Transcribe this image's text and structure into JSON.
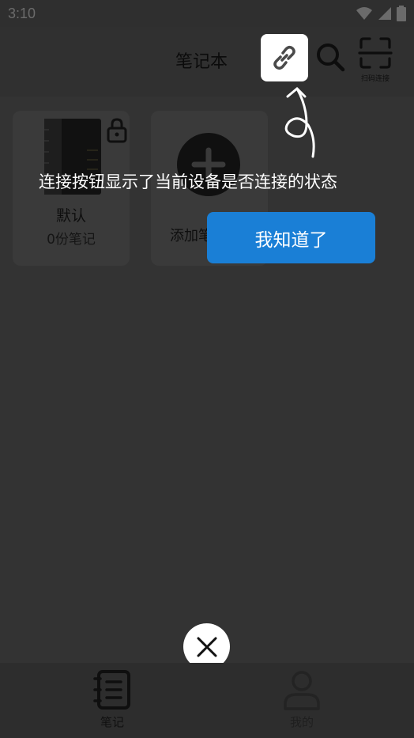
{
  "status": {
    "time": "3:10"
  },
  "header": {
    "title": "笔记本",
    "scan_label": "扫码连接"
  },
  "notebooks": [
    {
      "name": "默认",
      "count": "0份笔记"
    }
  ],
  "add_notebook": {
    "label": "添加笔"
  },
  "coach": {
    "tip": "连接按钮显示了当前设备是否连接的状态",
    "ok_label": "我知道了"
  },
  "tabs": [
    {
      "label": "笔记"
    },
    {
      "label": "我的"
    }
  ],
  "colors": {
    "accent": "#1a7fd6",
    "overlay": "#333333"
  },
  "icons": [
    "wifi-icon",
    "signal-icon",
    "battery-icon",
    "link-icon",
    "search-icon",
    "scan-icon",
    "notebook-icon",
    "lock-icon",
    "plus-icon",
    "close-icon",
    "notes-tab-icon",
    "profile-tab-icon",
    "curly-arrow-icon"
  ]
}
